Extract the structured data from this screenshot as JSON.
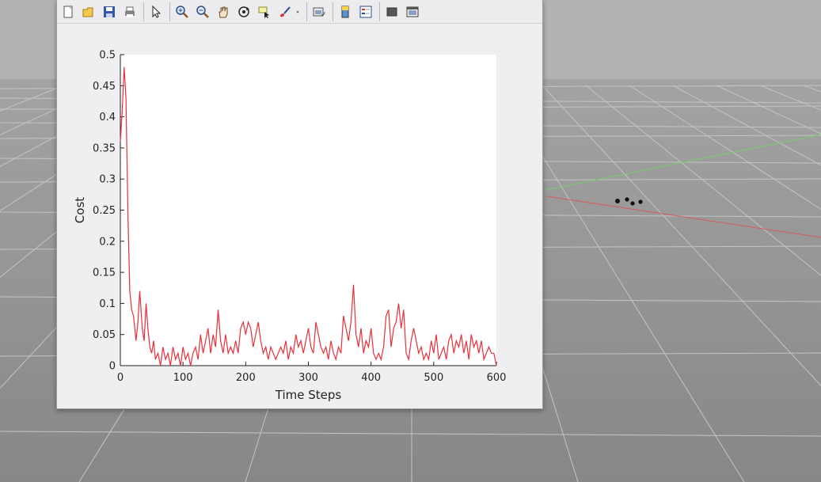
{
  "toolbar": {
    "buttons": [
      {
        "name": "new-figure-icon"
      },
      {
        "name": "open-file-icon"
      },
      {
        "name": "save-icon"
      },
      {
        "name": "print-icon"
      },
      {
        "sep": true
      },
      {
        "name": "pointer-icon"
      },
      {
        "sep": true
      },
      {
        "name": "zoom-in-icon"
      },
      {
        "name": "zoom-out-icon"
      },
      {
        "name": "pan-hand-icon"
      },
      {
        "name": "rotate-3d-icon"
      },
      {
        "name": "data-cursor-icon"
      },
      {
        "name": "brush-icon"
      },
      {
        "name": "dropdown-arrow-icon"
      },
      {
        "sep": true
      },
      {
        "name": "link-plot-icon"
      },
      {
        "sep": true
      },
      {
        "name": "colorbar-icon"
      },
      {
        "name": "legend-icon"
      },
      {
        "sep": true
      },
      {
        "name": "hide-plot-tools-icon"
      },
      {
        "name": "show-plot-tools-icon"
      }
    ]
  },
  "chart_data": {
    "type": "line",
    "title": "",
    "xlabel": "Time Steps",
    "ylabel": "Cost",
    "xlim": [
      0,
      600
    ],
    "ylim": [
      0,
      0.5
    ],
    "xticks": [
      "0",
      "100",
      "200",
      "300",
      "400",
      "500",
      "600"
    ],
    "yticks": [
      "0",
      "0.05",
      "0.1",
      "0.15",
      "0.2",
      "0.25",
      "0.3",
      "0.35",
      "0.4",
      "0.45",
      "0.5"
    ],
    "grid": false,
    "series_color": "#e8303a",
    "series": [
      {
        "x": [
          0,
          3,
          6,
          9,
          12,
          15,
          18,
          21,
          25,
          28,
          31,
          35,
          38,
          41,
          44,
          47,
          50,
          53,
          56,
          60,
          64,
          68,
          72,
          76,
          80,
          84,
          88,
          92,
          96,
          100,
          104,
          108,
          112,
          116,
          120,
          124,
          128,
          132,
          136,
          140,
          144,
          148,
          152,
          156,
          160,
          164,
          168,
          172,
          176,
          180,
          184,
          188,
          192,
          196,
          200,
          204,
          208,
          212,
          216,
          220,
          224,
          228,
          232,
          236,
          240,
          244,
          248,
          252,
          256,
          260,
          264,
          268,
          272,
          276,
          280,
          284,
          288,
          292,
          296,
          300,
          304,
          308,
          312,
          316,
          320,
          324,
          328,
          332,
          336,
          340,
          344,
          348,
          352,
          356,
          360,
          364,
          368,
          372,
          376,
          380,
          384,
          388,
          392,
          396,
          400,
          404,
          408,
          412,
          416,
          420,
          424,
          428,
          432,
          436,
          440,
          444,
          448,
          452,
          456,
          460,
          464,
          468,
          472,
          476,
          480,
          484,
          488,
          492,
          496,
          500,
          504,
          508,
          512,
          516,
          520,
          524,
          528,
          532,
          536,
          540,
          544,
          548,
          552,
          556,
          560,
          564,
          568,
          572,
          576,
          580,
          584,
          588,
          592,
          596,
          600
        ],
        "y": [
          0.36,
          0.41,
          0.48,
          0.43,
          0.25,
          0.12,
          0.09,
          0.08,
          0.04,
          0.07,
          0.12,
          0.06,
          0.04,
          0.1,
          0.06,
          0.03,
          0.02,
          0.04,
          0.01,
          0.02,
          0.0,
          0.03,
          0.01,
          0.02,
          0.0,
          0.03,
          0.01,
          0.02,
          0.0,
          0.03,
          0.01,
          0.02,
          0.0,
          0.02,
          0.03,
          0.01,
          0.05,
          0.02,
          0.04,
          0.06,
          0.02,
          0.05,
          0.03,
          0.09,
          0.04,
          0.02,
          0.05,
          0.02,
          0.03,
          0.02,
          0.04,
          0.02,
          0.06,
          0.07,
          0.05,
          0.07,
          0.06,
          0.03,
          0.05,
          0.07,
          0.04,
          0.02,
          0.03,
          0.01,
          0.03,
          0.02,
          0.01,
          0.02,
          0.03,
          0.02,
          0.04,
          0.01,
          0.03,
          0.02,
          0.05,
          0.03,
          0.04,
          0.02,
          0.04,
          0.06,
          0.03,
          0.02,
          0.07,
          0.05,
          0.03,
          0.02,
          0.03,
          0.01,
          0.04,
          0.02,
          0.01,
          0.03,
          0.02,
          0.08,
          0.06,
          0.04,
          0.07,
          0.13,
          0.05,
          0.03,
          0.06,
          0.02,
          0.04,
          0.03,
          0.06,
          0.02,
          0.01,
          0.02,
          0.01,
          0.03,
          0.08,
          0.09,
          0.03,
          0.06,
          0.07,
          0.1,
          0.06,
          0.09,
          0.02,
          0.01,
          0.04,
          0.06,
          0.04,
          0.02,
          0.03,
          0.01,
          0.02,
          0.01,
          0.04,
          0.02,
          0.05,
          0.01,
          0.02,
          0.03,
          0.01,
          0.04,
          0.05,
          0.02,
          0.04,
          0.03,
          0.05,
          0.02,
          0.04,
          0.01,
          0.05,
          0.03,
          0.04,
          0.02,
          0.04,
          0.01,
          0.02,
          0.03,
          0.02,
          0.02,
          0.0
        ]
      }
    ]
  }
}
